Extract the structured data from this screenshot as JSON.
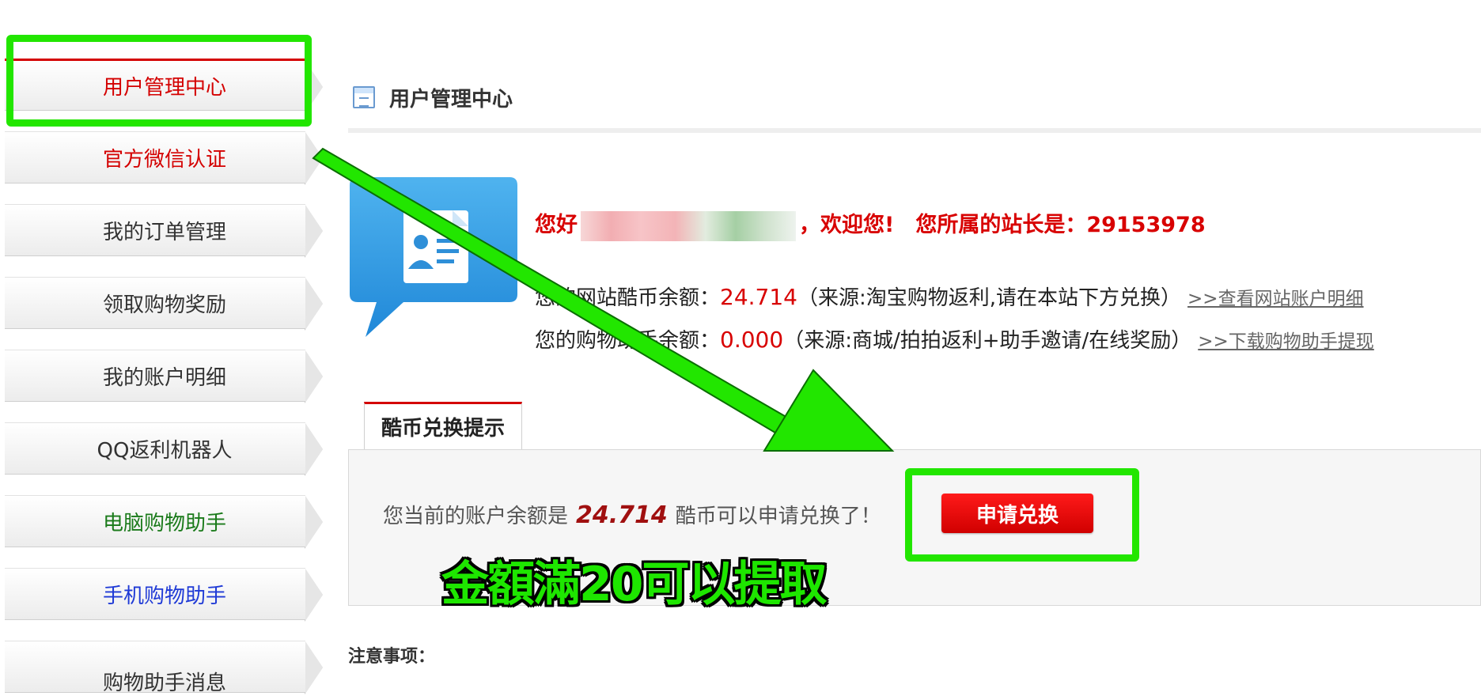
{
  "sidebar": {
    "items": [
      {
        "label": "用户管理中心",
        "color": "#d40000"
      },
      {
        "label": "官方微信认证",
        "color": "#d40000"
      },
      {
        "label": "我的订单管理",
        "color": "#333333"
      },
      {
        "label": "领取购物奖励",
        "color": "#333333"
      },
      {
        "label": "我的账户明细",
        "color": "#333333"
      },
      {
        "label": "QQ返利机器人",
        "color": "#333333"
      },
      {
        "label": "电脑购物助手",
        "color": "#1a7a1a"
      },
      {
        "label": "手机购物助手",
        "color": "#1f3ad6"
      },
      {
        "label": "购物助手消息",
        "color": "#333333"
      }
    ]
  },
  "header": {
    "title": "用户管理中心",
    "icon": "document-icon"
  },
  "user": {
    "greeting_prefix": "您好",
    "greeting_suffix": "，欢迎您!　您所属的站长是：29153978",
    "site_balance_label": "您的网站酷币余额：",
    "site_balance": "24.714",
    "site_balance_source": "（来源:淘宝购物返利,请在本站下方兑换）",
    "site_link": ">>查看网站账户明细",
    "assistant_balance_label": "您的购物助手余额：",
    "assistant_balance": "0.000",
    "assistant_balance_source": "（来源:商城/拍拍返利+助手邀请/在线奖励）",
    "assistant_link": ">>下载购物助手提现"
  },
  "exchange": {
    "tab_label": "酷币兑换提示",
    "text_prefix": "您当前的账户余额是",
    "amount": "24.714",
    "text_suffix": "酷币可以申请兑换了！",
    "button_label": "申请兑换"
  },
  "annotation": {
    "caption": "金額滿20可以提取",
    "color": "#22e600"
  },
  "notice": {
    "label": "注意事项："
  }
}
